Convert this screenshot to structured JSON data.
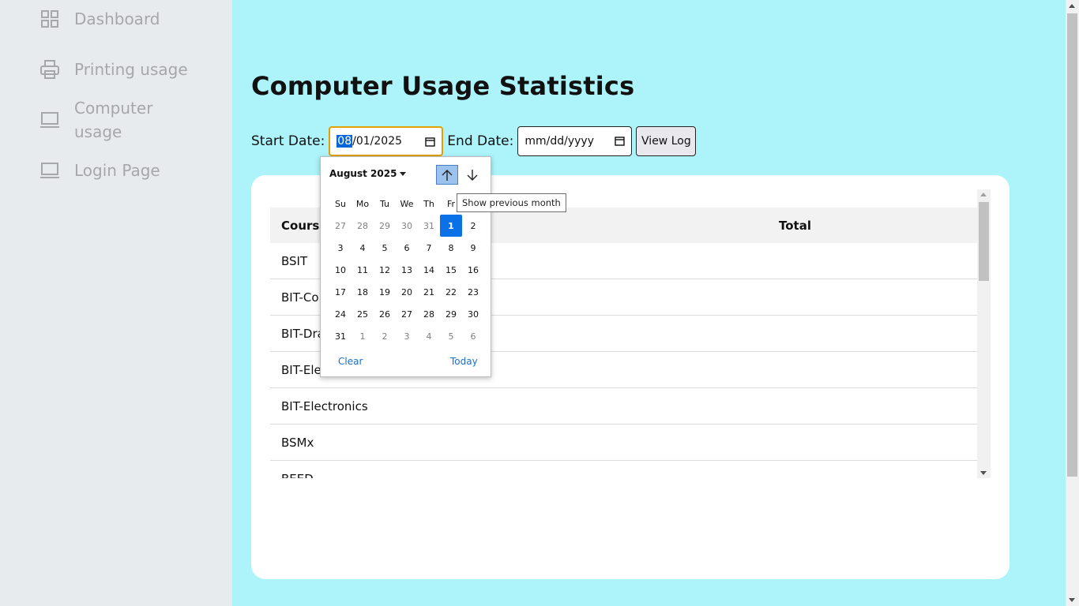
{
  "sidebar": {
    "items": [
      {
        "label": "Dashboard",
        "icon": "grid-icon"
      },
      {
        "label": "Printing usage",
        "icon": "printer-icon"
      },
      {
        "label": "Computer usage",
        "icon": "laptop-icon"
      },
      {
        "label": "Login Page",
        "icon": "laptop-icon"
      }
    ]
  },
  "main": {
    "title": "Computer Usage Statistics",
    "filters": {
      "start_label": "Start Date:",
      "start_value_month": "08",
      "start_value_rest": "/01/2025",
      "end_label": "End Date:",
      "end_placeholder": "mm/dd/yyyy",
      "view_button": "View Log"
    },
    "table": {
      "headers": [
        "Course",
        "Total"
      ],
      "rows": [
        "BSIT",
        "BIT-Computer",
        "BIT-Drafting",
        "BIT-Electrical",
        "BIT-Electronics",
        "BSMx",
        "BEED"
      ]
    }
  },
  "datepicker": {
    "month_label": "August 2025",
    "weekdays": [
      "Su",
      "Mo",
      "Tu",
      "We",
      "Th",
      "Fr",
      "Sa"
    ],
    "weeks": [
      [
        "27",
        "28",
        "29",
        "30",
        "31",
        "1",
        "2"
      ],
      [
        "3",
        "4",
        "5",
        "6",
        "7",
        "8",
        "9"
      ],
      [
        "10",
        "11",
        "12",
        "13",
        "14",
        "15",
        "16"
      ],
      [
        "17",
        "18",
        "19",
        "20",
        "21",
        "22",
        "23"
      ],
      [
        "24",
        "25",
        "26",
        "27",
        "28",
        "29",
        "30"
      ],
      [
        "31",
        "1",
        "2",
        "3",
        "4",
        "5",
        "6"
      ]
    ],
    "selected_day": "1",
    "clear_label": "Clear",
    "today_label": "Today",
    "tooltip": "Show previous month"
  },
  "colors": {
    "main_bg": "#acf4fa",
    "sidebar_bg": "#e8ebee",
    "selected_day": "#0a72e6",
    "link": "#1a6fc9",
    "focus_border": "#e1a100"
  }
}
